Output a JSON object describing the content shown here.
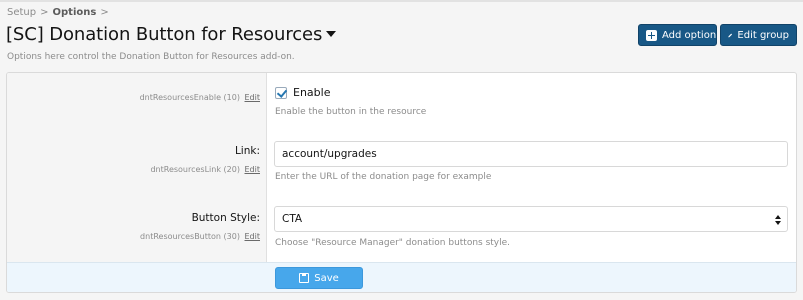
{
  "breadcrumb": {
    "items": [
      "Setup",
      "Options"
    ],
    "separator": ">"
  },
  "page": {
    "title": "[SC] Donation Button for Resources",
    "description": "Options here control the Donation Button for Resources add-on."
  },
  "header_buttons": {
    "add_option": "Add option",
    "edit_group": "Edit group"
  },
  "options": {
    "enable": {
      "meta": "dntResourcesEnable (10)",
      "edit_label": "Edit",
      "checkbox_label": "Enable",
      "checked": true,
      "hint": "Enable the button in the resource"
    },
    "link": {
      "label": "Link:",
      "meta": "dntResourcesLink (20)",
      "edit_label": "Edit",
      "value": "account/upgrades",
      "hint": "Enter the URL of the donation page for example"
    },
    "button_style": {
      "label": "Button Style:",
      "meta": "dntResourcesButton (30)",
      "edit_label": "Edit",
      "value": "CTA",
      "hint": "Choose \"Resource Manager\" donation buttons style."
    }
  },
  "footer": {
    "save_label": "Save"
  },
  "colors": {
    "primary_button": "#185886",
    "save_button": "#47a7eb",
    "footer_bar": "#edf6fd",
    "checkbox_check": "#2577b1"
  },
  "icons": {
    "add_option": "plus-square-icon",
    "edit_group": "pencil-icon",
    "save": "floppy-disk-icon",
    "title_menu": "caret-down-icon"
  }
}
